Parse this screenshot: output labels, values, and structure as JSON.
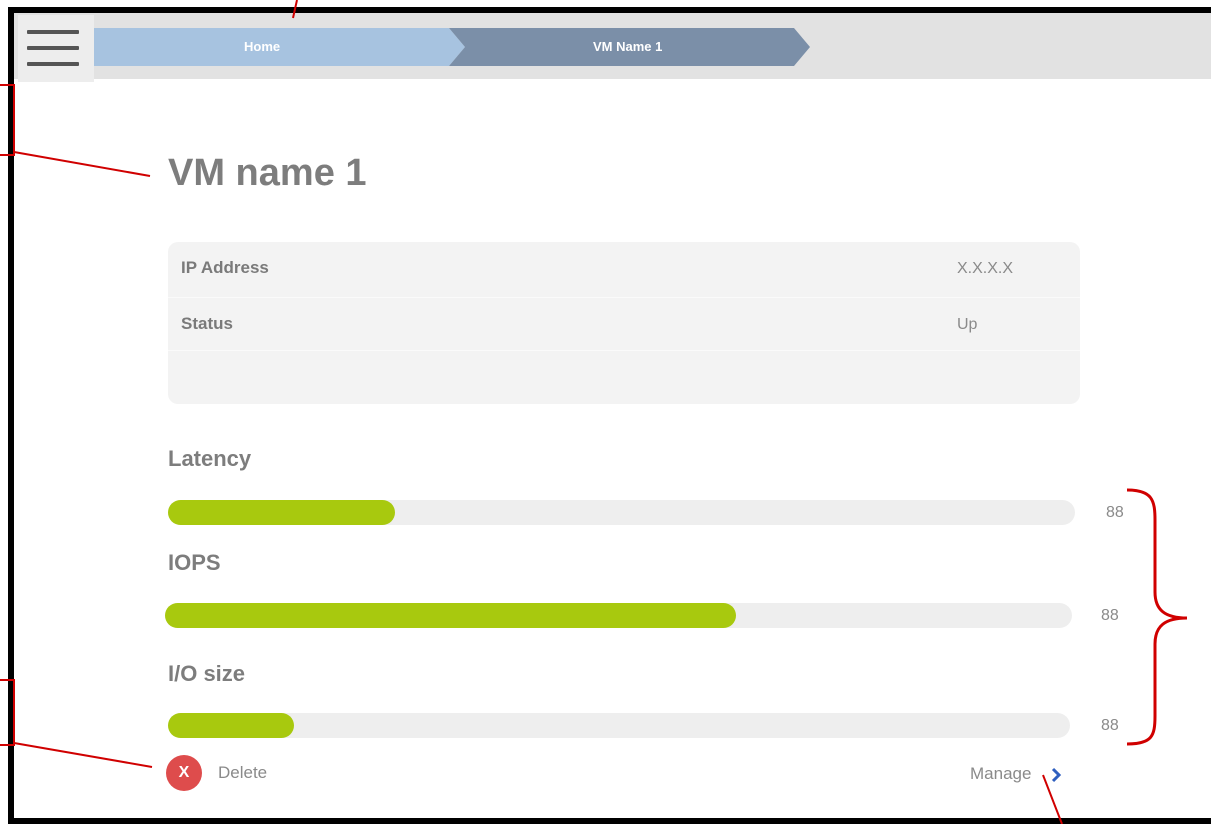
{
  "breadcrumb": {
    "items": [
      {
        "label": "Home",
        "fill": "#a7c3e0"
      },
      {
        "label": "VM Name 1",
        "fill": "#7b8fa8"
      }
    ]
  },
  "page": {
    "title": "VM name 1"
  },
  "info": {
    "rows": [
      {
        "key": "IP Address",
        "value": "X.X.X.X"
      },
      {
        "key": "Status",
        "value": "Up"
      },
      {
        "key": "",
        "value": ""
      }
    ]
  },
  "metrics": [
    {
      "label": "Latency",
      "value": "88",
      "fill_fraction": 0.25
    },
    {
      "label": "IOPS",
      "value": "88",
      "fill_fraction": 0.63
    },
    {
      "label": "I/O size",
      "value": "88",
      "fill_fraction": 0.14
    }
  ],
  "actions": {
    "delete_icon_text": "X",
    "delete_label": "Delete",
    "manage_label": "Manage"
  },
  "colors": {
    "accent_green": "#a8c90e",
    "delete_red": "#de4c4c",
    "manage_blue": "#2f5fbf",
    "annotation_red": "#d00000"
  },
  "icons": {
    "menu": "hamburger-menu-icon",
    "delete": "delete-x-icon",
    "manage": "chevron-right-icon"
  }
}
